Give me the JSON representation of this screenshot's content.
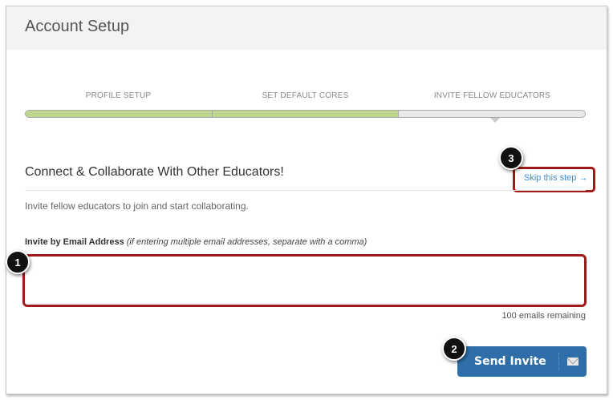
{
  "header": {
    "title": "Account Setup"
  },
  "steps": [
    {
      "label": "PROFILE SETUP",
      "complete": true
    },
    {
      "label": "SET DEFAULT CORES",
      "complete": true
    },
    {
      "label": "INVITE FELLOW EDUCATORS",
      "complete": false
    }
  ],
  "progress": {
    "completed_steps": 2,
    "total_steps": 3
  },
  "section": {
    "heading": "Connect & Collaborate With Other Educators!",
    "skip_label": "Skip this step →",
    "description": "Invite fellow educators to join and start collaborating."
  },
  "invite": {
    "label": "Invite by Email Address",
    "hint": "(if entering multiple email addresses, separate with a comma)",
    "value": "",
    "remaining": "100 emails remaining",
    "send_label": "Send Invite"
  },
  "callouts": [
    "1",
    "2",
    "3"
  ],
  "colors": {
    "accent": "#2f6ea8",
    "progress": "#bfd58e",
    "highlight": "#a01a1a",
    "link": "#3b8ed8"
  }
}
